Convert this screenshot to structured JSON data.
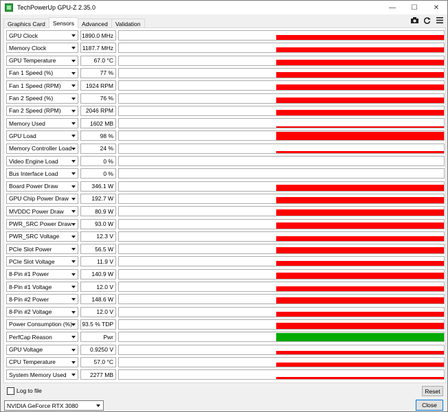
{
  "window": {
    "title": "TechPowerUp GPU-Z 2.35.0",
    "controls": {
      "minimize": "—",
      "maximize": "☐",
      "close": "✕"
    }
  },
  "tabs": [
    {
      "label": "Graphics Card",
      "active": false
    },
    {
      "label": "Sensors",
      "active": true
    },
    {
      "label": "Advanced",
      "active": false
    },
    {
      "label": "Validation",
      "active": false
    }
  ],
  "toolbar_icons": [
    "camera-icon",
    "refresh-icon",
    "menu-icon"
  ],
  "colors": {
    "graph_red": "#ff0000",
    "graph_green": "#00aa00"
  },
  "sensors": [
    {
      "name": "GPU Clock",
      "value": "1890.0 MHz",
      "level": 0.55,
      "color": "red"
    },
    {
      "name": "Memory Clock",
      "value": "1187.7 MHz",
      "level": 0.5,
      "color": "red"
    },
    {
      "name": "GPU Temperature",
      "value": "67.0 °C",
      "level": 0.6,
      "color": "red"
    },
    {
      "name": "Fan 1 Speed (%)",
      "value": "77 %",
      "level": 0.6,
      "color": "red"
    },
    {
      "name": "Fan 1 Speed (RPM)",
      "value": "1924 RPM",
      "level": 0.6,
      "color": "red"
    },
    {
      "name": "Fan 2 Speed (%)",
      "value": "76 %",
      "level": 0.6,
      "color": "red"
    },
    {
      "name": "Fan 2 Speed (RPM)",
      "value": "2046 RPM",
      "level": 0.6,
      "color": "red"
    },
    {
      "name": "Memory Used",
      "value": "1602 MB",
      "level": 0.15,
      "color": "red"
    },
    {
      "name": "GPU Load",
      "value": "98 %",
      "level": 0.95,
      "color": "red"
    },
    {
      "name": "Memory Controller Load",
      "value": "24 %",
      "level": 0.25,
      "color": "red"
    },
    {
      "name": "Video Engine Load",
      "value": "0 %",
      "level": 0,
      "color": "red"
    },
    {
      "name": "Bus Interface Load",
      "value": "0 %",
      "level": 0,
      "color": "red"
    },
    {
      "name": "Board Power Draw",
      "value": "346.1 W",
      "level": 0.7,
      "color": "red"
    },
    {
      "name": "GPU Chip Power Draw",
      "value": "192.7 W",
      "level": 0.7,
      "color": "red"
    },
    {
      "name": "MVDDC Power Draw",
      "value": "80.9 W",
      "level": 0.7,
      "color": "red"
    },
    {
      "name": "PWR_SRC Power Draw",
      "value": "93.0 W",
      "level": 0.7,
      "color": "red"
    },
    {
      "name": "PWR_SRC Voltage",
      "value": "12.3 V",
      "level": 0.55,
      "color": "red"
    },
    {
      "name": "PCIe Slot Power",
      "value": "56.5 W",
      "level": 0.7,
      "color": "red"
    },
    {
      "name": "PCIe Slot Voltage",
      "value": "11.9 V",
      "level": 0.5,
      "color": "red"
    },
    {
      "name": "8-Pin #1 Power",
      "value": "140.9 W",
      "level": 0.7,
      "color": "red"
    },
    {
      "name": "8-Pin #1 Voltage",
      "value": "12.0 V",
      "level": 0.55,
      "color": "red"
    },
    {
      "name": "8-Pin #2 Power",
      "value": "148.6 W",
      "level": 0.7,
      "color": "red"
    },
    {
      "name": "8-Pin #2 Voltage",
      "value": "12.0 V",
      "level": 0.55,
      "color": "red"
    },
    {
      "name": "Power Consumption (%)",
      "value": "93.5 % TDP",
      "level": 0.7,
      "color": "red"
    },
    {
      "name": "PerfCap Reason",
      "value": "Pwr",
      "level": 0.95,
      "color": "green"
    },
    {
      "name": "GPU Voltage",
      "value": "0.9250 V",
      "level": 0.35,
      "color": "red"
    },
    {
      "name": "CPU Temperature",
      "value": "57.0 °C",
      "level": 0.45,
      "color": "red"
    },
    {
      "name": "System Memory Used",
      "value": "2277 MB",
      "level": 0.2,
      "color": "red"
    }
  ],
  "footer": {
    "log_label": "Log to file",
    "log_checked": false,
    "reset_label": "Reset",
    "gpu_selected": "NVIDIA GeForce RTX 3080",
    "close_label": "Close"
  }
}
